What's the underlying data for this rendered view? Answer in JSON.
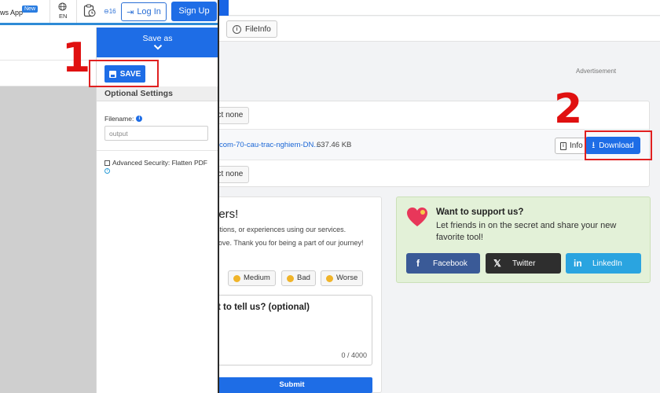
{
  "right_page": {
    "toolbar": {
      "fileinfo_label": "FileInfo"
    },
    "advertisement_label": "Advertisement",
    "file_panel": {
      "select_none_label": "ect none",
      "file_name": "com-70-cau-trac-nghiem-DN...",
      "file_size": "637.46 KB",
      "info_label": "Info",
      "download_label": "Download"
    },
    "feedback": {
      "title": "tters!",
      "text_line1": "estions, or experiences using our services.",
      "text_line2": "prove. Thank you for being a part of our journey!",
      "ratings": [
        "Medium",
        "Bad",
        "Worse"
      ],
      "question": "nt to tell us? (optional)",
      "counter": "0 / 4000",
      "submit_label": "Submit"
    },
    "support": {
      "title": "Want to support us?",
      "text": "Let friends in on the secret and share your new favorite tool!",
      "facebook_label": "Facebook",
      "twitter_label": "Twitter",
      "linkedin_label": "LinkedIn"
    }
  },
  "left_page": {
    "topbar": {
      "app_text": "ws App",
      "new_badge": "New",
      "lang": "EN",
      "count": "16",
      "login_label": "Log In",
      "signup_label": "Sign Up"
    },
    "side_panel": {
      "saveas_title": "Save as",
      "save_label": "SAVE",
      "optional_title": "Optional Settings",
      "filename_label": "Filename:",
      "filename_placeholder": "output",
      "advanced_label": "Advanced Security: Flatten PDF"
    }
  },
  "annotations": {
    "step1": "1",
    "step2": "2"
  },
  "colors": {
    "accent": "#1e6de6",
    "annotation": "#e01010",
    "support_bg": "#e3f1d8"
  }
}
